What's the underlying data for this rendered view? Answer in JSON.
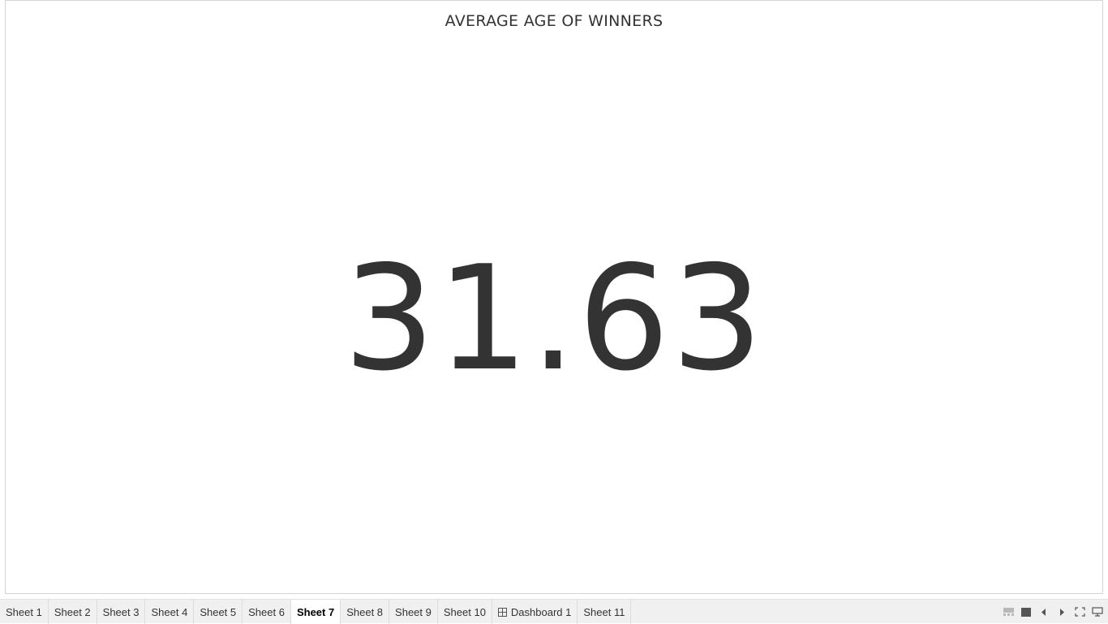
{
  "viz": {
    "title": "AVERAGE AGE OF WINNERS",
    "kpi_value": "31.63"
  },
  "tabs": [
    {
      "label": "Sheet 1",
      "active": false,
      "type": "sheet"
    },
    {
      "label": "Sheet 2",
      "active": false,
      "type": "sheet"
    },
    {
      "label": "Sheet 3",
      "active": false,
      "type": "sheet"
    },
    {
      "label": "Sheet 4",
      "active": false,
      "type": "sheet"
    },
    {
      "label": "Sheet 5",
      "active": false,
      "type": "sheet"
    },
    {
      "label": "Sheet 6",
      "active": false,
      "type": "sheet"
    },
    {
      "label": "Sheet 7",
      "active": true,
      "type": "sheet"
    },
    {
      "label": "Sheet 8",
      "active": false,
      "type": "sheet"
    },
    {
      "label": "Sheet 9",
      "active": false,
      "type": "sheet"
    },
    {
      "label": "Sheet 10",
      "active": false,
      "type": "sheet"
    },
    {
      "label": "Dashboard 1",
      "active": false,
      "type": "dashboard"
    },
    {
      "label": "Sheet 11",
      "active": false,
      "type": "sheet"
    }
  ],
  "controls": [
    {
      "name": "filmstrip-view-icon"
    },
    {
      "name": "single-view-icon"
    },
    {
      "name": "previous-sheet-icon"
    },
    {
      "name": "next-sheet-icon"
    },
    {
      "name": "fullscreen-icon"
    },
    {
      "name": "presentation-mode-icon"
    }
  ],
  "colors": {
    "text": "#333333",
    "tab_bar_bg": "#f0f0f0",
    "active_tab_bg": "#ffffff"
  }
}
